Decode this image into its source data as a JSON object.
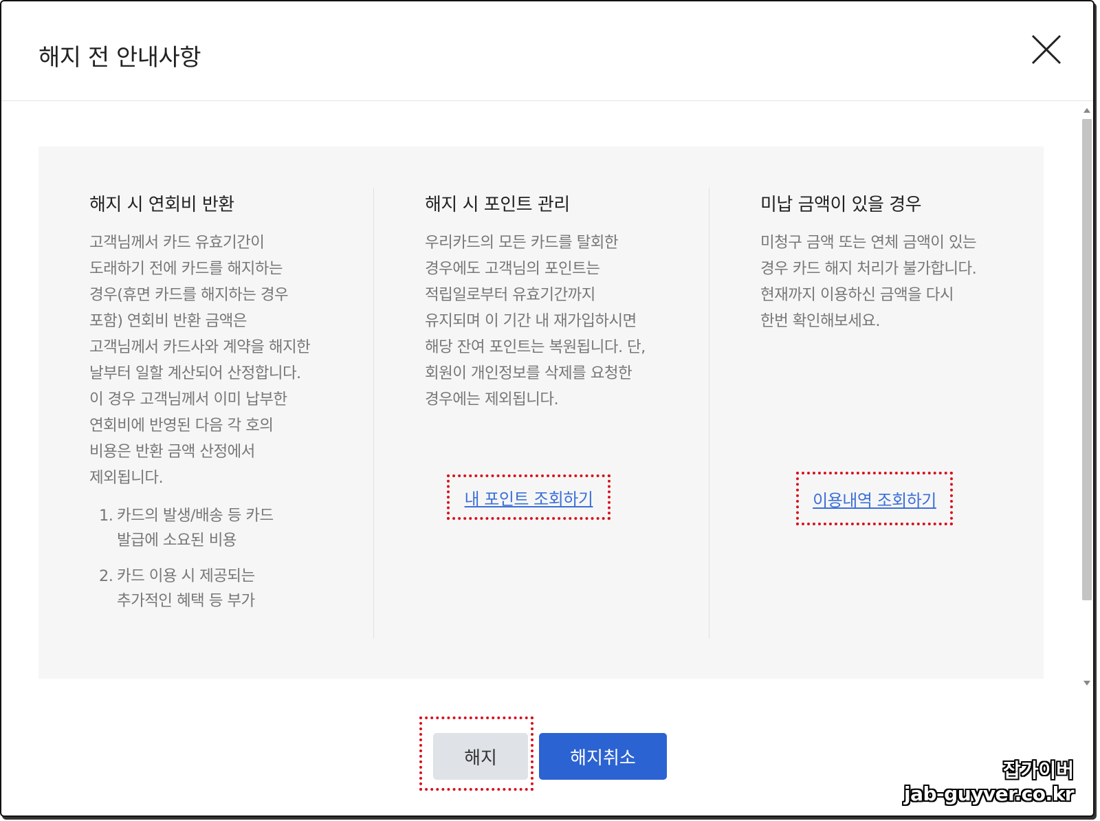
{
  "dialog": {
    "title": "해지 전 안내사항",
    "close_icon": "close-icon"
  },
  "columns": [
    {
      "title": "해지 시 연회비 반환",
      "lines": [
        "고객님께서 카드 유효기간이",
        "도래하기 전에 카드를 해지하는",
        "경우(휴면 카드를 해지하는 경우",
        "포함) 연회비 반환 금액은",
        "고객님께서 카드사와 계약을 해지한",
        "날부터 일할 계산되어 산정합니다.",
        "이 경우 고객님께서 이미 납부한",
        "연회비에 반영된 다음 각 호의",
        "비용은 반환 금액 산정에서",
        "제외됩니다."
      ],
      "items": [
        {
          "num": "1.",
          "lines": [
            "카드의 발생/배송 등 카드",
            "발급에 소요된 비용"
          ]
        },
        {
          "num": "2.",
          "lines": [
            "카드 이용 시 제공되는",
            "추가적인 혜택 등 부가"
          ]
        }
      ]
    },
    {
      "title": "해지 시 포인트 관리",
      "lines": [
        "우리카드의 모든 카드를 탈회한",
        "경우에도 고객님의 포인트는",
        "적립일로부터 유효기간까지",
        "유지되며 이 기간 내 재가입하시면",
        "해당 잔여 포인트는 복원됩니다. 단,",
        "회원이 개인정보를 삭제를 요청한",
        "경우에는 제외됩니다."
      ],
      "link": "내 포인트 조회하기"
    },
    {
      "title": "미납 금액이 있을 경우",
      "lines": [
        "미청구 금액 또는 연체 금액이 있는",
        "경우 카드 해지 처리가 불가합니다.",
        "현재까지 이용하신 금액을 다시",
        "한번 확인해보세요."
      ],
      "link": "이용내역 조회하기"
    }
  ],
  "buttons": {
    "terminate": "해지",
    "cancel_termination": "해지취소"
  },
  "watermark": {
    "line1": "잡가이버",
    "line2": "jab-guyver.co.kr"
  },
  "colors": {
    "primary": "#2c63d2",
    "link": "#3b6fd8",
    "highlight": "#d9111b",
    "panel_bg": "#f6f6f6"
  }
}
